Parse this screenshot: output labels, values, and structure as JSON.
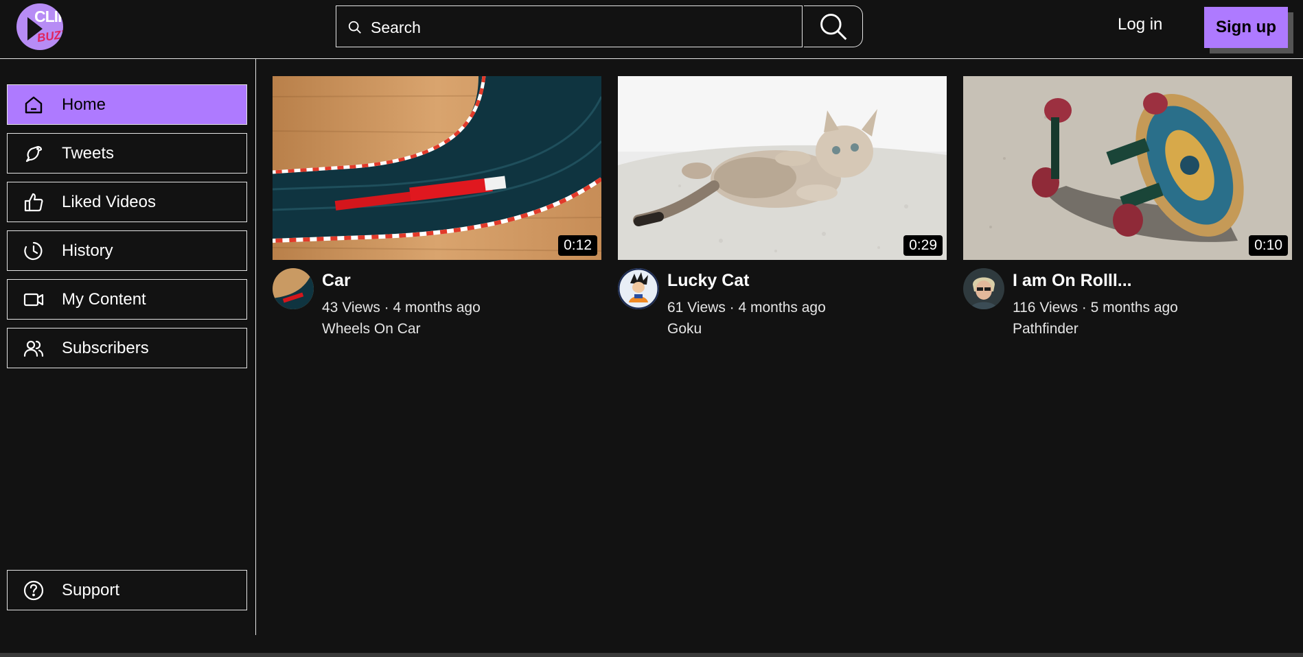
{
  "header": {
    "logo_text_top": "CLIP",
    "logo_text_bottom": "BUZZ",
    "search_placeholder": "Search",
    "login_label": "Log in",
    "signup_label": "Sign up"
  },
  "sidebar": {
    "items": [
      {
        "label": "Home",
        "icon": "home-icon",
        "active": true
      },
      {
        "label": "Tweets",
        "icon": "bird-icon"
      },
      {
        "label": "Liked Videos",
        "icon": "thumbs-up-icon"
      },
      {
        "label": "History",
        "icon": "history-icon"
      },
      {
        "label": "My Content",
        "icon": "video-camera-icon"
      },
      {
        "label": "Subscribers",
        "icon": "users-icon"
      }
    ],
    "support": {
      "label": "Support",
      "icon": "help-circle-icon"
    }
  },
  "videos": [
    {
      "title": "Car",
      "duration": "0:12",
      "meta": "43 Views · 4 months ago",
      "channel": "Wheels On Car"
    },
    {
      "title": "Lucky Cat",
      "duration": "0:29",
      "meta": "61 Views · 4 months ago",
      "channel": "Goku"
    },
    {
      "title": "I am On Rolll...",
      "duration": "0:10",
      "meta": "116 Views · 5 months ago",
      "channel": "Pathfinder"
    }
  ],
  "colors": {
    "accent": "#ae7aff",
    "background": "#121212",
    "border": "#e6e6e6"
  }
}
